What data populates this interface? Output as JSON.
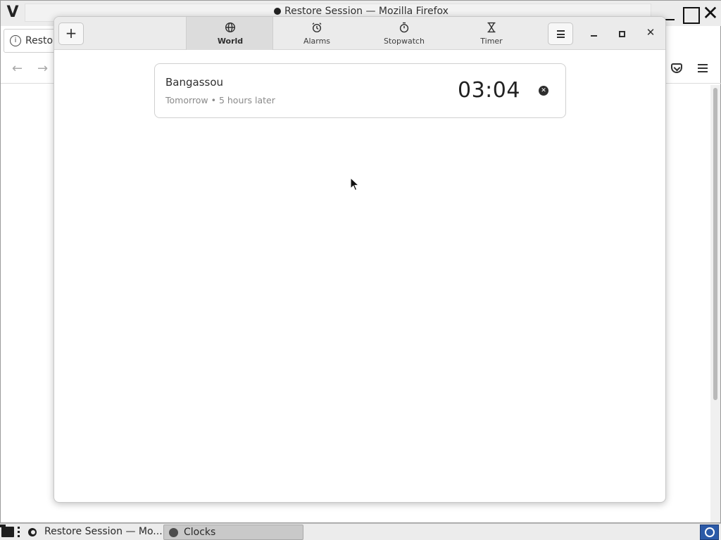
{
  "firefox": {
    "title": "Restore Session — Mozilla Firefox",
    "url_fragment": "Restor",
    "back_glyph": "←",
    "forward_glyph": "→",
    "menu_glyph": "V",
    "close_glyph": "✕"
  },
  "clocks": {
    "add_label": "+",
    "tabs": [
      {
        "label": "World",
        "icon": "globe-icon",
        "selected": true
      },
      {
        "label": "Alarms",
        "icon": "alarm-clock-icon",
        "selected": false
      },
      {
        "label": "Stopwatch",
        "icon": "stopwatch-icon",
        "selected": false
      },
      {
        "label": "Timer",
        "icon": "hourglass-icon",
        "selected": false
      }
    ],
    "close_glyph": "✕",
    "world": {
      "city": "Bangassou",
      "subtitle": "Tomorrow • 5 hours later",
      "time": "03:04",
      "remove_glyph": "✕"
    }
  },
  "taskbar": {
    "firefox_label": "Restore Session — Mo...",
    "clocks_label": "Clocks"
  }
}
